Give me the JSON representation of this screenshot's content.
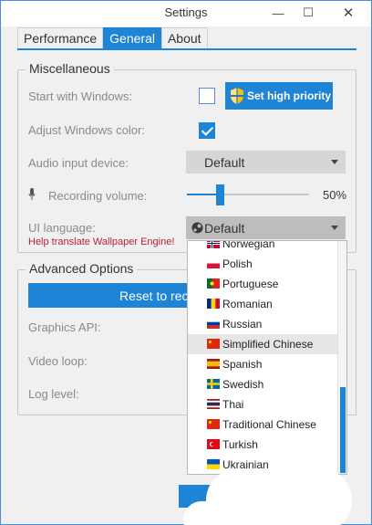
{
  "window": {
    "title": "Settings",
    "minimize": "—",
    "maximize": "☐",
    "close": "✕"
  },
  "tabs": [
    "Performance",
    "General",
    "About"
  ],
  "misc": {
    "legend": "Miscellaneous",
    "start_label": "Start with Windows:",
    "priority_button": "Set high priority",
    "adjust_label": "Adjust Windows color:",
    "audio_label": "Audio input device:",
    "audio_value": "Default",
    "volume_label": "Recording volume:",
    "volume_value": "50%",
    "volume_fraction": 0.27,
    "lang_label": "UI language:",
    "lang_value": "Default",
    "help_link": "Help translate Wallpaper Engine!"
  },
  "advanced": {
    "legend": "Advanced Options",
    "reset_button": "Reset to rec",
    "graphics_label": "Graphics API:",
    "video_label": "Video loop:",
    "log_label": "Log level:"
  },
  "languages": [
    {
      "name": "Norwegian",
      "flag": "norway"
    },
    {
      "name": "Polish",
      "flag": "poland"
    },
    {
      "name": "Portuguese",
      "flag": "portugal"
    },
    {
      "name": "Romanian",
      "flag": "romania"
    },
    {
      "name": "Russian",
      "flag": "russia"
    },
    {
      "name": "Simplified Chinese",
      "flag": "china",
      "highlighted": true
    },
    {
      "name": "Spanish",
      "flag": "spain"
    },
    {
      "name": "Swedish",
      "flag": "sweden"
    },
    {
      "name": "Thai",
      "flag": "thailand"
    },
    {
      "name": "Traditional Chinese",
      "flag": "china"
    },
    {
      "name": "Turkish",
      "flag": "turkey"
    },
    {
      "name": "Ukrainian",
      "flag": "ukraine"
    }
  ],
  "colors": {
    "accent": "#1e84d6",
    "link": "#b5213b",
    "window_bg": "#f0f0f0"
  }
}
